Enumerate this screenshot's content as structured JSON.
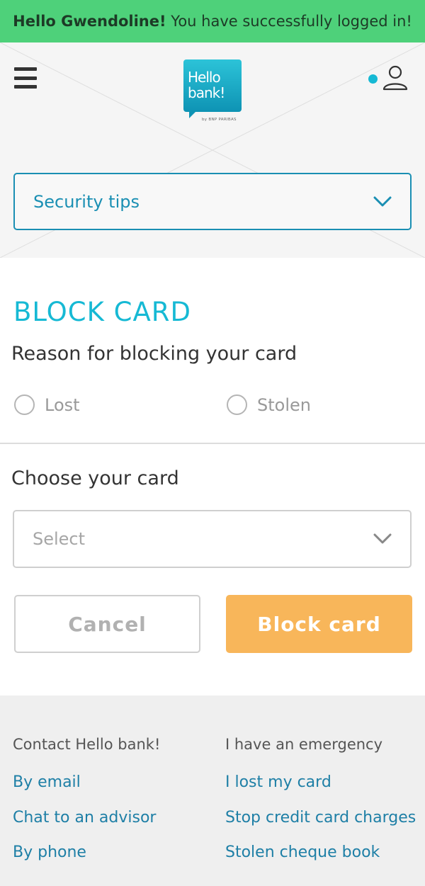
{
  "banner": {
    "name": "Hello Gwendoline!",
    "message": "You have successfully logged in!"
  },
  "header": {
    "logo_line1": "Hello",
    "logo_line2": "bank!",
    "logo_sub": "by BNP PARIBAS"
  },
  "security": {
    "label": "Security tips"
  },
  "page": {
    "title": "BLOCK CARD",
    "reason_heading": "Reason for blocking your card",
    "reason_options": [
      "Lost",
      "Stolen"
    ],
    "card_heading": "Choose your card",
    "card_select_placeholder": "Select",
    "cancel_label": "Cancel",
    "block_label": "Block card"
  },
  "footer": {
    "contact": {
      "heading": "Contact Hello bank!",
      "links": [
        "By email",
        "Chat to an advisor",
        "By phone"
      ]
    },
    "emergency": {
      "heading": "I have an emergency",
      "links": [
        "I lost my card",
        "Stop credit card charges",
        "Stolen cheque book"
      ]
    }
  },
  "colors": {
    "accent": "#16b9d4",
    "banner": "#4ed17a",
    "block_button": "#f8b65a",
    "link": "#1e7fa6"
  },
  "icons": {
    "menu": "menu-icon",
    "user": "user-icon",
    "chevron": "chevron-down-icon"
  }
}
